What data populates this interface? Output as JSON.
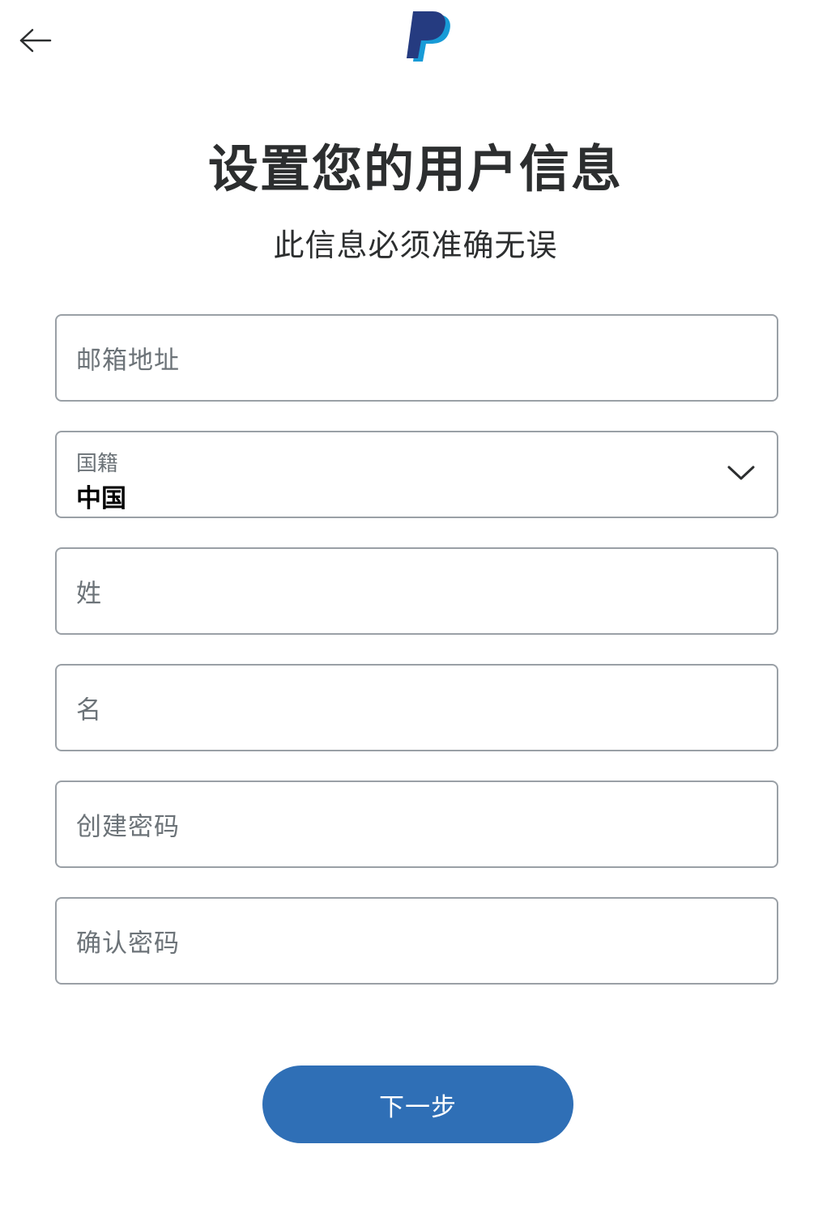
{
  "header": {
    "back_icon": "arrow-left-icon",
    "logo_icon": "paypal-logo"
  },
  "title": "设置您的用户信息",
  "subtitle": "此信息必须准确无误",
  "form": {
    "email_placeholder": "邮箱地址",
    "nationality_label": "国籍",
    "nationality_value": "中国",
    "last_name_placeholder": "姓",
    "first_name_placeholder": "名",
    "create_password_placeholder": "创建密码",
    "confirm_password_placeholder": "确认密码"
  },
  "actions": {
    "next_label": "下一步"
  },
  "colors": {
    "primary_button": "#2f6fb6",
    "logo_dark": "#253b80",
    "logo_light": "#179bd7",
    "border": "#9aa0a6"
  }
}
